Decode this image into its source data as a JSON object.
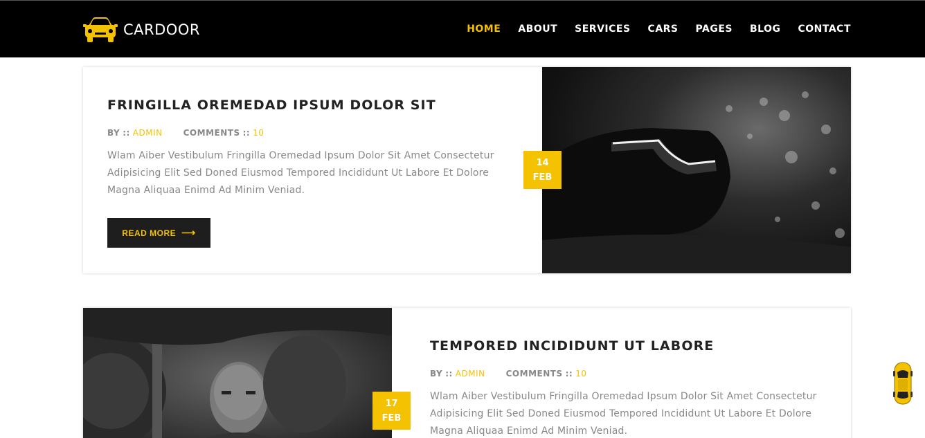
{
  "brand": {
    "name": "CARDOOR",
    "logo_icon": "car-front-icon"
  },
  "nav": {
    "items": [
      {
        "label": "HOME",
        "active": true
      },
      {
        "label": "ABOUT",
        "active": false
      },
      {
        "label": "SERVICES",
        "active": false
      },
      {
        "label": "CARS",
        "active": false
      },
      {
        "label": "PAGES",
        "active": false
      },
      {
        "label": "BLOG",
        "active": false
      },
      {
        "label": "CONTACT",
        "active": false
      }
    ]
  },
  "colors": {
    "accent": "#f5c201",
    "header_bg": "#000000",
    "dark_button": "#1e1e1e",
    "text_muted": "#888888"
  },
  "posts": [
    {
      "title": "FRINGILLA OREMEDAD IPSUM DOLOR SIT",
      "by_label": "BY",
      "separator": "::",
      "author": "ADMIN",
      "comments_label": "COMMENTS",
      "comments_count": "10",
      "excerpt": "Wlam Aiber Vestibulum Fringilla Oremedad Ipsum Dolor Sit Amet Consectetur Adipisicing Elit Sed Doned Eiusmod Tempored Incididunt Ut Labore Et Dolore Magna Aliquaa Enimd Ad Minim Veniad.",
      "read_more": "READ MORE",
      "date_day": "14",
      "date_month": "FEB"
    },
    {
      "title": "TEMPORED INCIDIDUNT UT LABORE",
      "by_label": "BY",
      "separator": "::",
      "author": "ADMIN",
      "comments_label": "COMMENTS",
      "comments_count": "10",
      "excerpt": "Wlam Aiber Vestibulum Fringilla Oremedad Ipsum Dolor Sit Amet Consectetur Adipisicing Elit Sed Doned Eiusmod Tempored Incididunt Ut Labore Et Dolore Magna Aliquaa Enimd Ad Minim Veniad.",
      "date_day": "17",
      "date_month": "FEB"
    }
  ],
  "floating_widget": {
    "icon": "yellow-car-icon"
  }
}
